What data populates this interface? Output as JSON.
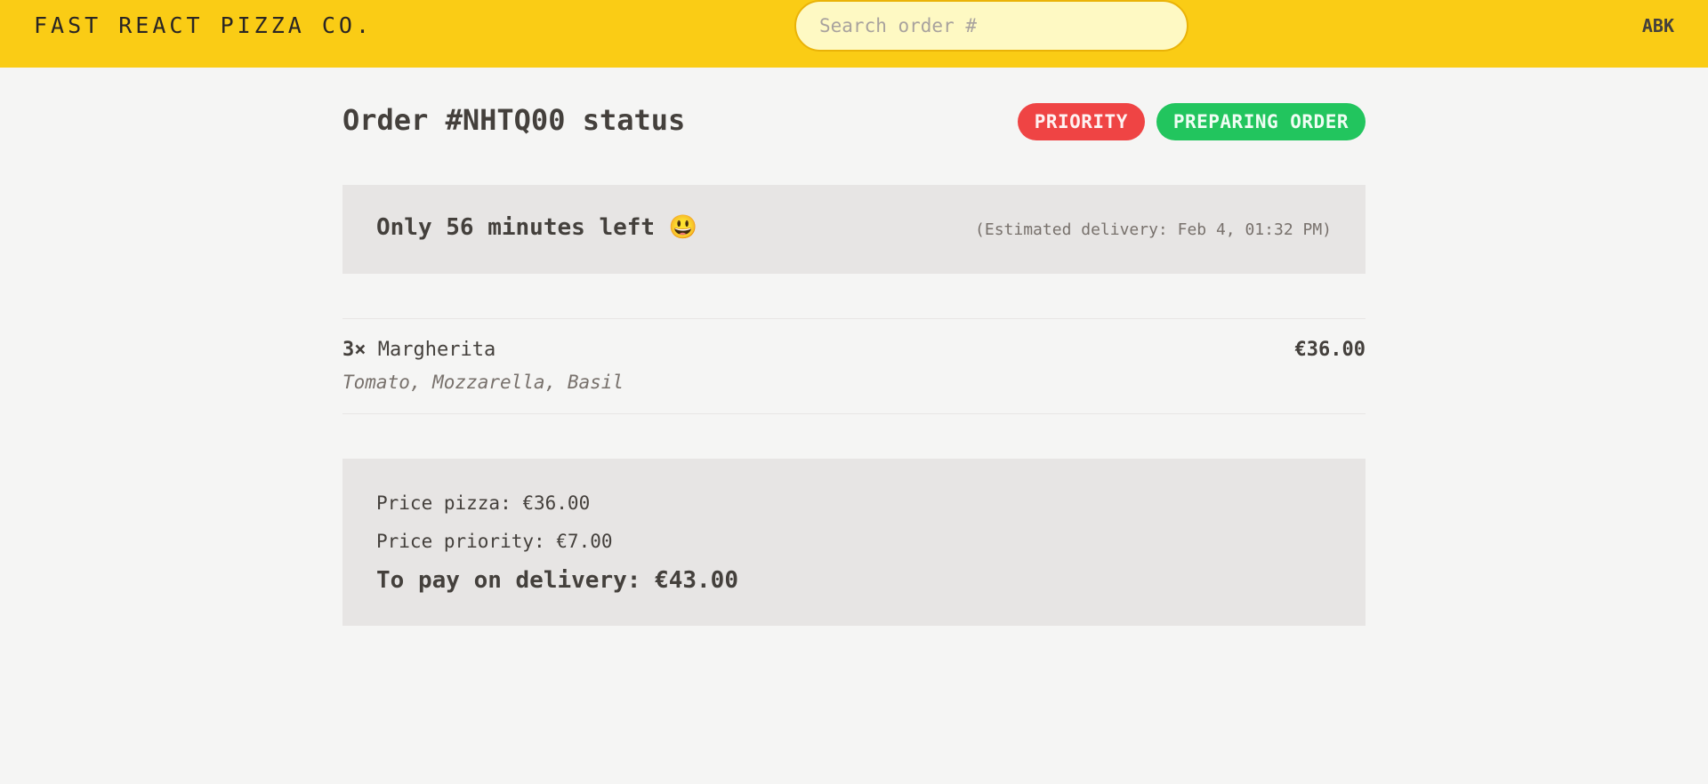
{
  "header": {
    "logo": "FAST REACT PIZZA CO.",
    "search_placeholder": "Search order #",
    "search_value": "",
    "username": "ABK"
  },
  "order": {
    "title": "Order #NHTQ00 status",
    "badges": {
      "priority": "PRIORITY",
      "status": "PREPARING ORDER"
    },
    "eta": {
      "remaining": "Only 56 minutes left 😃",
      "estimated": "(Estimated delivery: Feb 4, 01:32 PM)"
    },
    "items": [
      {
        "qty": "3×",
        "name": "Margherita",
        "price": "€36.00",
        "ingredients": "Tomato, Mozzarella, Basil"
      }
    ],
    "summary": {
      "price_pizza": "Price pizza: €36.00",
      "price_priority": "Price priority: €7.00",
      "to_pay": "To pay on delivery: €43.00"
    }
  },
  "colors": {
    "header_bg": "#facc15",
    "priority_badge": "#ef4444",
    "status_badge": "#22c55e",
    "panel_bg": "#e7e5e4"
  }
}
